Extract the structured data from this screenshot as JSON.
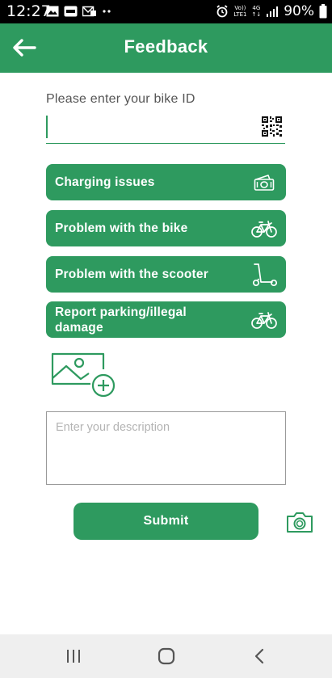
{
  "status_bar": {
    "time": "12:27",
    "battery": "90%",
    "volte_top": "Vo))",
    "volte_bottom": "LTE1",
    "network_top": "4G",
    "network_bottom": "↑↓"
  },
  "header": {
    "title": "Feedback",
    "back_icon": "arrow-left-icon",
    "background": "#2e9a5f"
  },
  "bike_id": {
    "label": "Please enter your bike ID",
    "value": "",
    "scan_icon": "qr-code-icon"
  },
  "issue_buttons": [
    {
      "label": "Charging issues",
      "icon": "charging-money-icon"
    },
    {
      "label": "Problem with the bike",
      "icon": "bicycle-icon"
    },
    {
      "label": "Problem with the scooter",
      "icon": "scooter-icon"
    },
    {
      "label": "Report parking/illegal damage",
      "icon": "bicycle-icon"
    }
  ],
  "add_image": {
    "icon": "add-image-icon"
  },
  "description": {
    "placeholder": "Enter your description",
    "value": ""
  },
  "submit": {
    "label": "Submit"
  },
  "camera": {
    "icon": "camera-icon"
  },
  "nav_bar": {
    "icons": [
      "recent-apps-icon",
      "home-icon",
      "back-icon"
    ]
  },
  "colors": {
    "accent": "#2e9a5f",
    "text_muted": "#555555",
    "placeholder": "#b4b4b4"
  }
}
